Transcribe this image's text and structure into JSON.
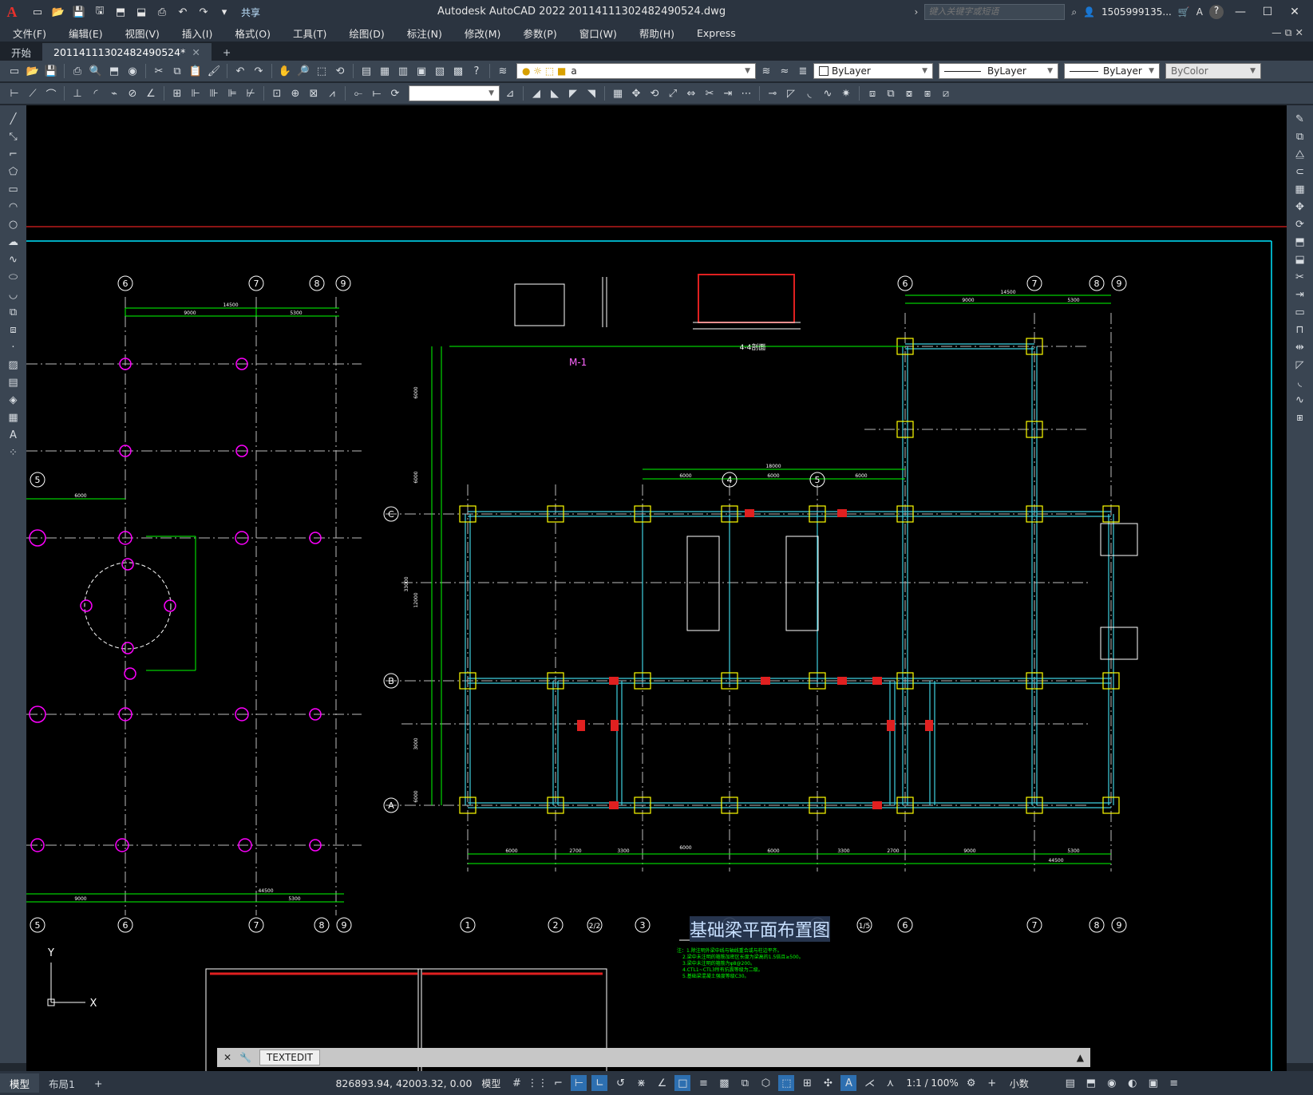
{
  "app": {
    "logo": "A",
    "title": "Autodesk AutoCAD 2022    20114111302482490524.dwg",
    "share": "共享",
    "search_placeholder": "键入关键字或短语",
    "user": "1505999135...",
    "help": "?"
  },
  "menu": [
    "文件(F)",
    "编辑(E)",
    "视图(V)",
    "插入(I)",
    "格式(O)",
    "工具(T)",
    "绘图(D)",
    "标注(N)",
    "修改(M)",
    "参数(P)",
    "窗口(W)",
    "帮助(H)",
    "Express"
  ],
  "tabs": {
    "start": "开始",
    "file": "20114111302482490524*",
    "add": "+"
  },
  "properties": {
    "layer": "a",
    "color": "ByLayer",
    "linetype": "ByLayer",
    "lineweight": "ByLayer",
    "plotstyle": "ByColor"
  },
  "drawing": {
    "title": "基础梁平面布置图",
    "label_m1": "M-1",
    "section_title": "4-4剖面",
    "axis_y": "Y",
    "axes_bottom": [
      "1",
      "2",
      "2/2",
      "3",
      "4",
      "5",
      "1/5",
      "6",
      "7",
      "8",
      "9"
    ],
    "axes_top_right": [
      "6",
      "7",
      "8",
      "9"
    ],
    "axes_top_left": [
      "6",
      "7",
      "8",
      "9"
    ],
    "axes_mid": [
      "4",
      "5"
    ],
    "axes_left_bottom": [
      "5",
      "6",
      "7",
      "8",
      "9"
    ],
    "axes_row": [
      "C",
      "B",
      "A"
    ],
    "axis_left_5": "5",
    "dims_bottom": [
      "6000",
      "2700",
      "3300",
      "6000",
      "6000",
      "3300",
      "2700",
      "9000",
      "5300"
    ],
    "dim_total": "44500",
    "dims_top_right": [
      "9000",
      "5300"
    ],
    "dim_top_right_total": "14500",
    "dims_mid": [
      "6000",
      "6000",
      "6000"
    ],
    "dim_mid_total": "18000",
    "dims_vert": [
      "6000",
      "6000",
      "12000",
      "3000",
      "6000",
      "33000"
    ],
    "notes": [
      "注：1.除注明外梁中线与轴线重合或与柱边平齐。",
      "2.梁中未注明的箍筋加密区长度为梁高的1.5倍且≥500。",
      "3.梁中未注明的箍筋为φ8@200。",
      "4.CTL1~CTL3所有抗震等级为二级。",
      "5.基础梁混凝土强度等级C30。"
    ]
  },
  "cmd": {
    "label": "TEXTEDIT"
  },
  "status": {
    "model_tab": "模型",
    "layout_tab": "布局1",
    "add": "+",
    "coords": "826893.94, 42003.32, 0.00",
    "model": "模型",
    "scale": "1:1 / 100%",
    "units": "小数"
  }
}
